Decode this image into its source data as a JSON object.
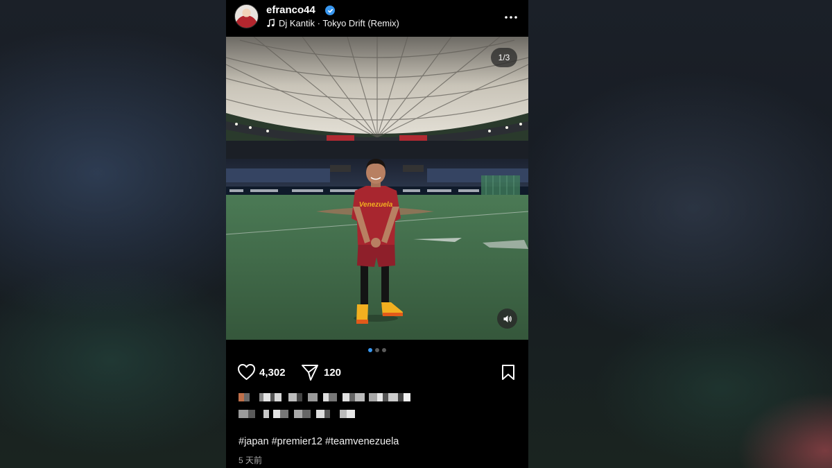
{
  "post": {
    "username": "efranco44",
    "music": "Dj Kantik · Tokyo Drift (Remix)",
    "media_counter": "1/3",
    "carousel": {
      "total": 3,
      "active": 1
    },
    "likes": "4,302",
    "shares": "120",
    "hashtags": [
      "#japan",
      "#premier12",
      "#teamvenezuela"
    ],
    "time_ago": "5 天前",
    "caption_line_1_obscured": "(pixelated)",
    "caption_line_2_obscured": "(pixelated)"
  },
  "icons": {
    "verified": "verified-badge-icon",
    "music": "music-note-icon",
    "more": "more-horizontal-icon",
    "like": "heart-icon",
    "share": "send-icon",
    "save": "bookmark-icon",
    "sound": "speaker-icon"
  },
  "colors": {
    "panel": "#000000",
    "verified": "#3897f0",
    "active_dot": "#3897f0",
    "inactive_dot": "#5a5a5a",
    "jersey": "#a8262f"
  }
}
